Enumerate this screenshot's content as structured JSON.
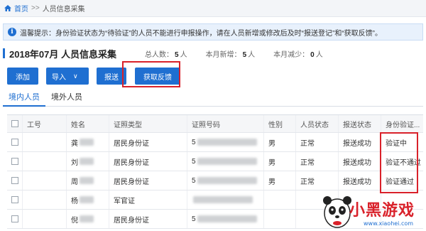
{
  "breadcrumb": {
    "home": "首页",
    "separator": ">>",
    "current": "人员信息采集"
  },
  "notice": {
    "text": "温馨提示：身份验证状态为“待验证”的人员不能进行申报操作，请在人员新增或修改后及时“报送登记”和“获取反馈”。"
  },
  "header": {
    "title": "2018年07月  人员信息采集",
    "stats": [
      {
        "label": "总人数：",
        "value": "5",
        "unit": "人"
      },
      {
        "label": "本月新增：",
        "value": "5",
        "unit": "人"
      },
      {
        "label": "本月减少：",
        "value": "0",
        "unit": "人"
      }
    ]
  },
  "toolbar": {
    "add_label": "添加",
    "import_label": "导入",
    "submit_label": "报送",
    "fetch_label": "获取反馈"
  },
  "tabs": [
    {
      "label": "境内人员"
    },
    {
      "label": "境外人员"
    }
  ],
  "table": {
    "columns": [
      "工号",
      "姓名",
      "证照类型",
      "证照号码",
      "性别",
      "人员状态",
      "报送状态",
      "身份验证..."
    ],
    "rows": [
      {
        "no": "",
        "name": "龚",
        "type": "居民身份证",
        "idno": "5",
        "gender": "男",
        "state": "正常",
        "submit": "报送成功",
        "verify": "验证中"
      },
      {
        "no": "",
        "name": "刘",
        "type": "居民身份证",
        "idno": "5",
        "gender": "男",
        "state": "正常",
        "submit": "报送成功",
        "verify": "验证不通过"
      },
      {
        "no": "",
        "name": "周",
        "type": "居民身份证",
        "idno": "5",
        "gender": "男",
        "state": "正常",
        "submit": "报送成功",
        "verify": "验证通过"
      },
      {
        "no": "",
        "name": "杨",
        "type": "军官证",
        "idno": "",
        "gender": "",
        "state": "",
        "submit": "",
        "verify": ""
      },
      {
        "no": "",
        "name": "倪",
        "type": "居民身份证",
        "idno": "5",
        "gender": "",
        "state": "",
        "submit": "",
        "verify": ""
      }
    ]
  },
  "watermark": {
    "text": "小黑游戏",
    "url": "www.xiaohei.com"
  },
  "colors": {
    "primary": "#1f6fd1",
    "highlight": "#d9212a"
  }
}
